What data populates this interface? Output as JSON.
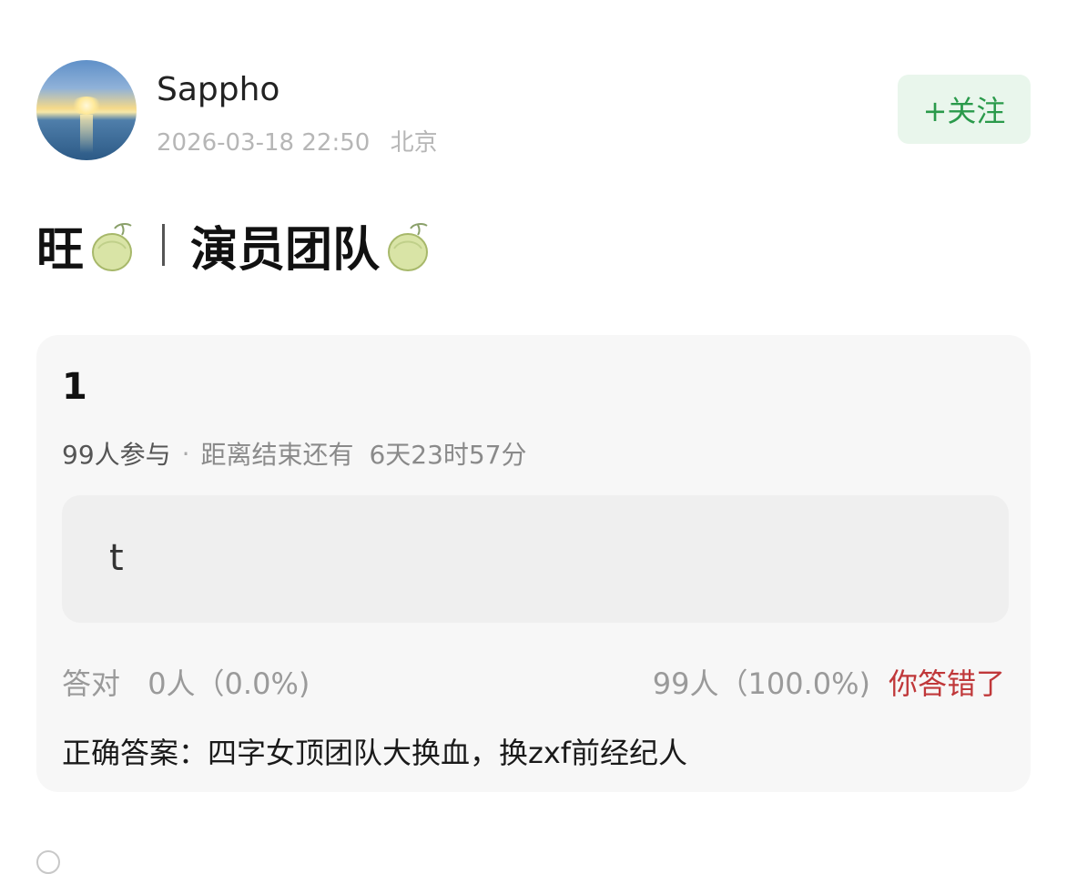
{
  "user": {
    "name": "Sappho",
    "datetime": "2026-03-18 22:50",
    "location": "北京",
    "avatar": "sunset-sea-avatar"
  },
  "follow_button": {
    "label": "+关注",
    "color": "#2a9a4b"
  },
  "post": {
    "title_left": "旺",
    "title_right": "演员团队",
    "emoji": "melon-emoji"
  },
  "quiz": {
    "number": "1",
    "participants": "99人参与",
    "separator": "·",
    "countdown_prefix": "距离结束还有",
    "countdown": "6天23时57分",
    "option_text": "t",
    "correct_label": "答对",
    "correct_stats": "0人（0.0%)",
    "wrong_stats": "99人（100.0%)",
    "wrong_status": "你答错了",
    "answer_label": "正确答案：",
    "answer_text": "四字女顶团队大换血，换zxf前经纪人",
    "status_color": "#c0383a"
  }
}
